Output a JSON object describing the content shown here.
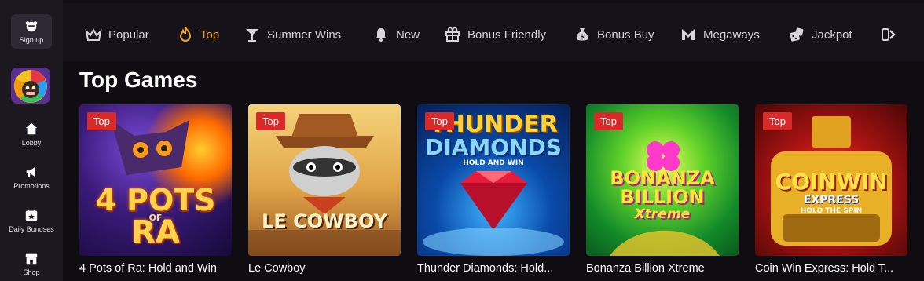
{
  "sidebar": {
    "signup_label": "Sign up",
    "items": [
      {
        "label": "Lobby",
        "icon": "home-icon"
      },
      {
        "label": "Promotions",
        "icon": "megaphone-icon"
      },
      {
        "label": "Daily Bonuses",
        "icon": "calendar-star-icon"
      },
      {
        "label": "Shop",
        "icon": "shop-icon"
      }
    ]
  },
  "nav": {
    "items": [
      {
        "label": "Popular",
        "icon": "crown-icon"
      },
      {
        "label": "Top",
        "icon": "flame-icon",
        "active": true
      },
      {
        "label": "Summer Wins",
        "icon": "cocktail-icon"
      },
      {
        "label": "New",
        "icon": "bell-icon"
      },
      {
        "label": "Bonus Friendly",
        "icon": "gift-icon"
      },
      {
        "label": "Bonus Buy",
        "icon": "money-bag-icon"
      },
      {
        "label": "Megaways",
        "icon": "megaways-icon"
      },
      {
        "label": "Jackpot",
        "icon": "dice-icon"
      }
    ],
    "active_color": "#f3a520"
  },
  "section": {
    "title": "Top Games",
    "badge_label": "Top",
    "games": [
      {
        "title": "4 Pots of Ra: Hold and Win",
        "art_line1": "4 POTS",
        "art_line2": "OF",
        "art_line3": "RA"
      },
      {
        "title": "Le Cowboy",
        "art_line1": "LE COWBOY"
      },
      {
        "title": "Thunder Diamonds: Hold...",
        "art_line1": "THUNDER",
        "art_line2": "DIAMONDS",
        "art_line3": "HOLD AND WIN"
      },
      {
        "title": "Bonanza Billion Xtreme",
        "art_line1": "BONANZA",
        "art_line2": "BILLION",
        "art_line3": "Xtreme"
      },
      {
        "title": "Coin Win Express: Hold T...",
        "art_line1": "COINWIN",
        "art_line2": "EXPRESS",
        "art_line3": "HOLD THE SPIN"
      }
    ]
  },
  "colors": {
    "badge": "#d92a2a",
    "accent": "#f3a520",
    "sidebar_bg": "#1b1820",
    "page_bg": "#0f0c12"
  }
}
